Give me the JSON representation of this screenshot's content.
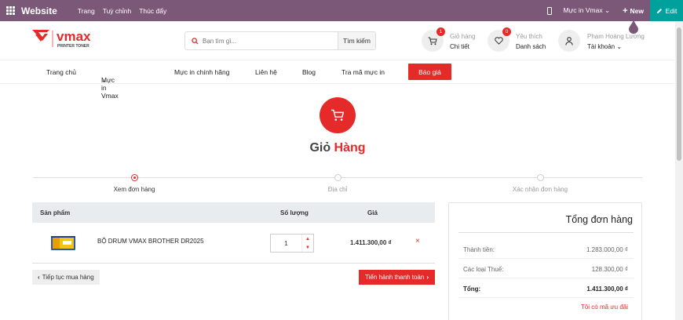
{
  "topbar": {
    "brand": "Website",
    "menus": [
      "Trang",
      "Tuỳ chỉnh",
      "Thúc đẩy"
    ],
    "site": "Mực in Vmax",
    "new_label": "New",
    "edit_label": "Edit",
    "bg_color": "#7c5878",
    "edit_color": "#00a09d"
  },
  "header": {
    "logo_text": "vmax",
    "logo_sub": "PRINTER TONER",
    "search_placeholder": "Bạn tìm gì...",
    "search_button": "Tìm kiếm",
    "cart": {
      "count": "1",
      "label": "Giỏ hàng",
      "sub": "Chi tiết"
    },
    "wishlist": {
      "count": "0",
      "label": "Yêu thích",
      "sub": "Danh sách"
    },
    "account": {
      "name": "Phạm Hoàng Lương",
      "sub": "Tài khoản"
    }
  },
  "nav": {
    "items": [
      "Trang chủ",
      "Mực in Vmax",
      "Mực in chính hãng",
      "Liên hệ",
      "Blog",
      "Tra mã mực in"
    ],
    "quote_button": "Báo giá",
    "accent": "#e52b29"
  },
  "page": {
    "title_a": "Giỏ ",
    "title_b": "Hàng"
  },
  "steps": [
    "Xem đơn hàng",
    "Địa chỉ",
    "Xác nhận đơn hàng"
  ],
  "cart_table": {
    "headers": {
      "product": "Sản phẩm",
      "quantity": "Số lượng",
      "price": "Giá"
    },
    "rows": [
      {
        "name": "BỘ DRUM VMAX BROTHER DR2025",
        "quantity": "1",
        "price": "1.411.300,00 ₫"
      }
    ],
    "back_label": "Tiếp tục mua hàng",
    "checkout_label": "Tiến hành thanh toán"
  },
  "summary": {
    "title": "Tổng đơn hàng",
    "subtotal_label": "Thành tiền:",
    "subtotal": "1.283.000,00 ₫",
    "tax_label": "Các loại Thuế:",
    "tax": "128.300,00 ₫",
    "total_label": "Tổng:",
    "total": "1.411.300,00 ₫",
    "promo": "Tôi có mã ưu đãi"
  }
}
